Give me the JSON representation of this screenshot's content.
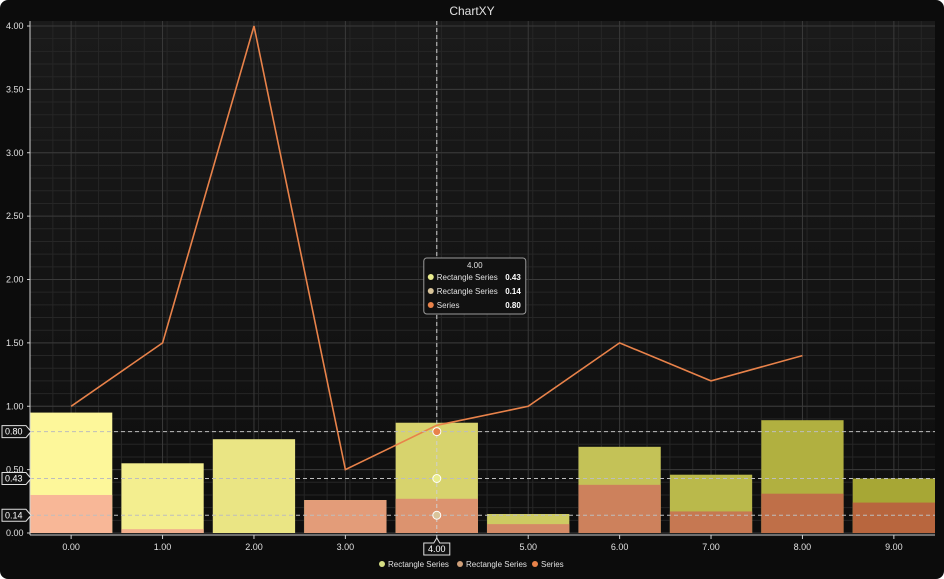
{
  "window": {
    "title": "ChartXY"
  },
  "chart_data": {
    "type": "bar",
    "title": "ChartXY",
    "x": [
      0,
      1,
      2,
      3,
      4,
      5,
      6,
      7,
      8,
      9
    ],
    "x_tick_labels": [
      "0.00",
      "1.00",
      "2.00",
      "3.00",
      "4.00",
      "5.00",
      "6.00",
      "7.00",
      "8.00",
      "9.00"
    ],
    "y_tick_labels": [
      "0.00",
      "0.50",
      "1.00",
      "1.50",
      "2.00",
      "2.50",
      "3.00",
      "3.50",
      "4.00"
    ],
    "xlim": [
      -0.45,
      9.45
    ],
    "ylim": [
      0,
      4.0
    ],
    "grid": true,
    "legend_position": "bottom",
    "series": [
      {
        "name": "Rectangle Series",
        "kind": "bar",
        "color": "#f4f27a",
        "values": [
          0.95,
          0.55,
          0.74,
          0.26,
          0.87,
          0.15,
          0.68,
          0.46,
          0.89,
          0.43
        ]
      },
      {
        "name": "Rectangle Series",
        "kind": "bar",
        "color": "#f3a37d",
        "values": [
          0.3,
          0.03,
          0.0,
          0.26,
          0.27,
          0.07,
          0.38,
          0.17,
          0.31,
          0.24
        ]
      },
      {
        "name": "Series",
        "kind": "line",
        "color": "#e8824a",
        "values": [
          1.0,
          1.5,
          4.0,
          0.5,
          0.85,
          1.0,
          1.5,
          1.2,
          1.4,
          null
        ]
      }
    ],
    "cursor": {
      "x": 4,
      "x_label": "4.00",
      "tooltip": {
        "header": "4.00",
        "rows": [
          {
            "name": "Rectangle Series",
            "value": "0.43",
            "color": "#e9ec8e"
          },
          {
            "name": "Rectangle Series",
            "value": "0.14",
            "color": "#d9c49a"
          },
          {
            "name": "Series",
            "value": "0.80",
            "color": "#e8824a"
          }
        ]
      },
      "y_markers": [
        "0.80",
        "0.43",
        "0.14"
      ],
      "y_marker_values": [
        0.8,
        0.43,
        0.14
      ]
    },
    "legend": [
      {
        "label": "Rectangle Series",
        "color": "#d6de84"
      },
      {
        "label": "Rectangle Series",
        "color": "#cf9f79"
      },
      {
        "label": "Series",
        "color": "#e8824a"
      }
    ]
  }
}
